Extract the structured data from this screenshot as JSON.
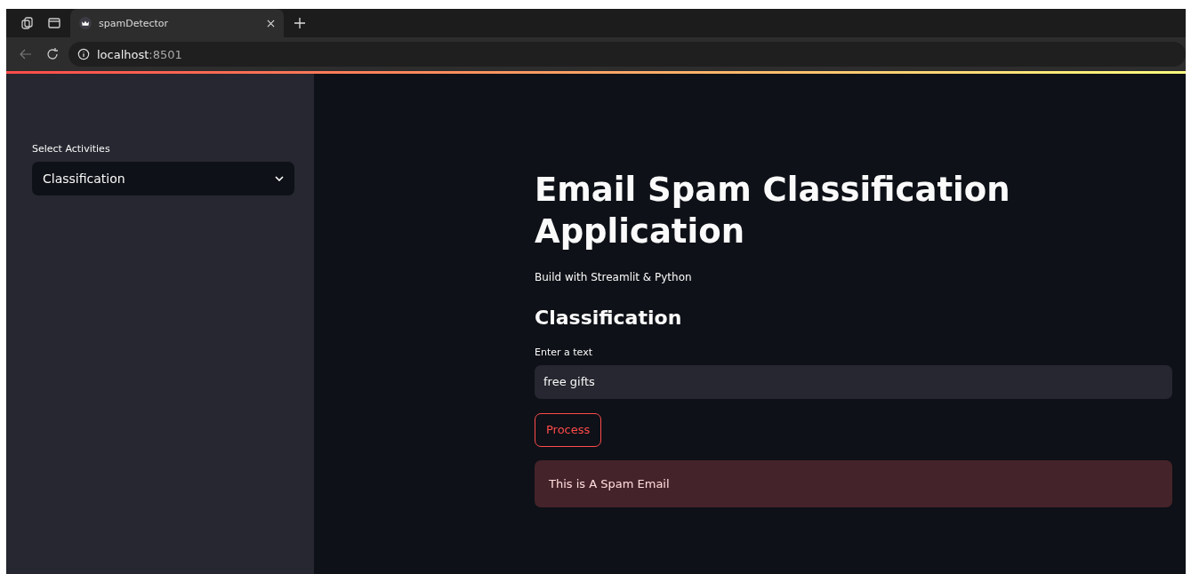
{
  "browser": {
    "tabs": [
      {
        "title": "spamDetector",
        "selected": true
      }
    ],
    "address": {
      "host": "localhost",
      "port": ":8501"
    }
  },
  "sidebar": {
    "select": {
      "label": "Select Activities",
      "value": "Classification"
    }
  },
  "main": {
    "title": "Email Spam Classification Application",
    "caption": "Build with Streamlit & Python",
    "subheader": "Classification",
    "input": {
      "label": "Enter a text",
      "value": "free gifts"
    },
    "button": {
      "label": "Process"
    },
    "alert": {
      "kind": "error",
      "text": "This is A Spam Email"
    }
  }
}
